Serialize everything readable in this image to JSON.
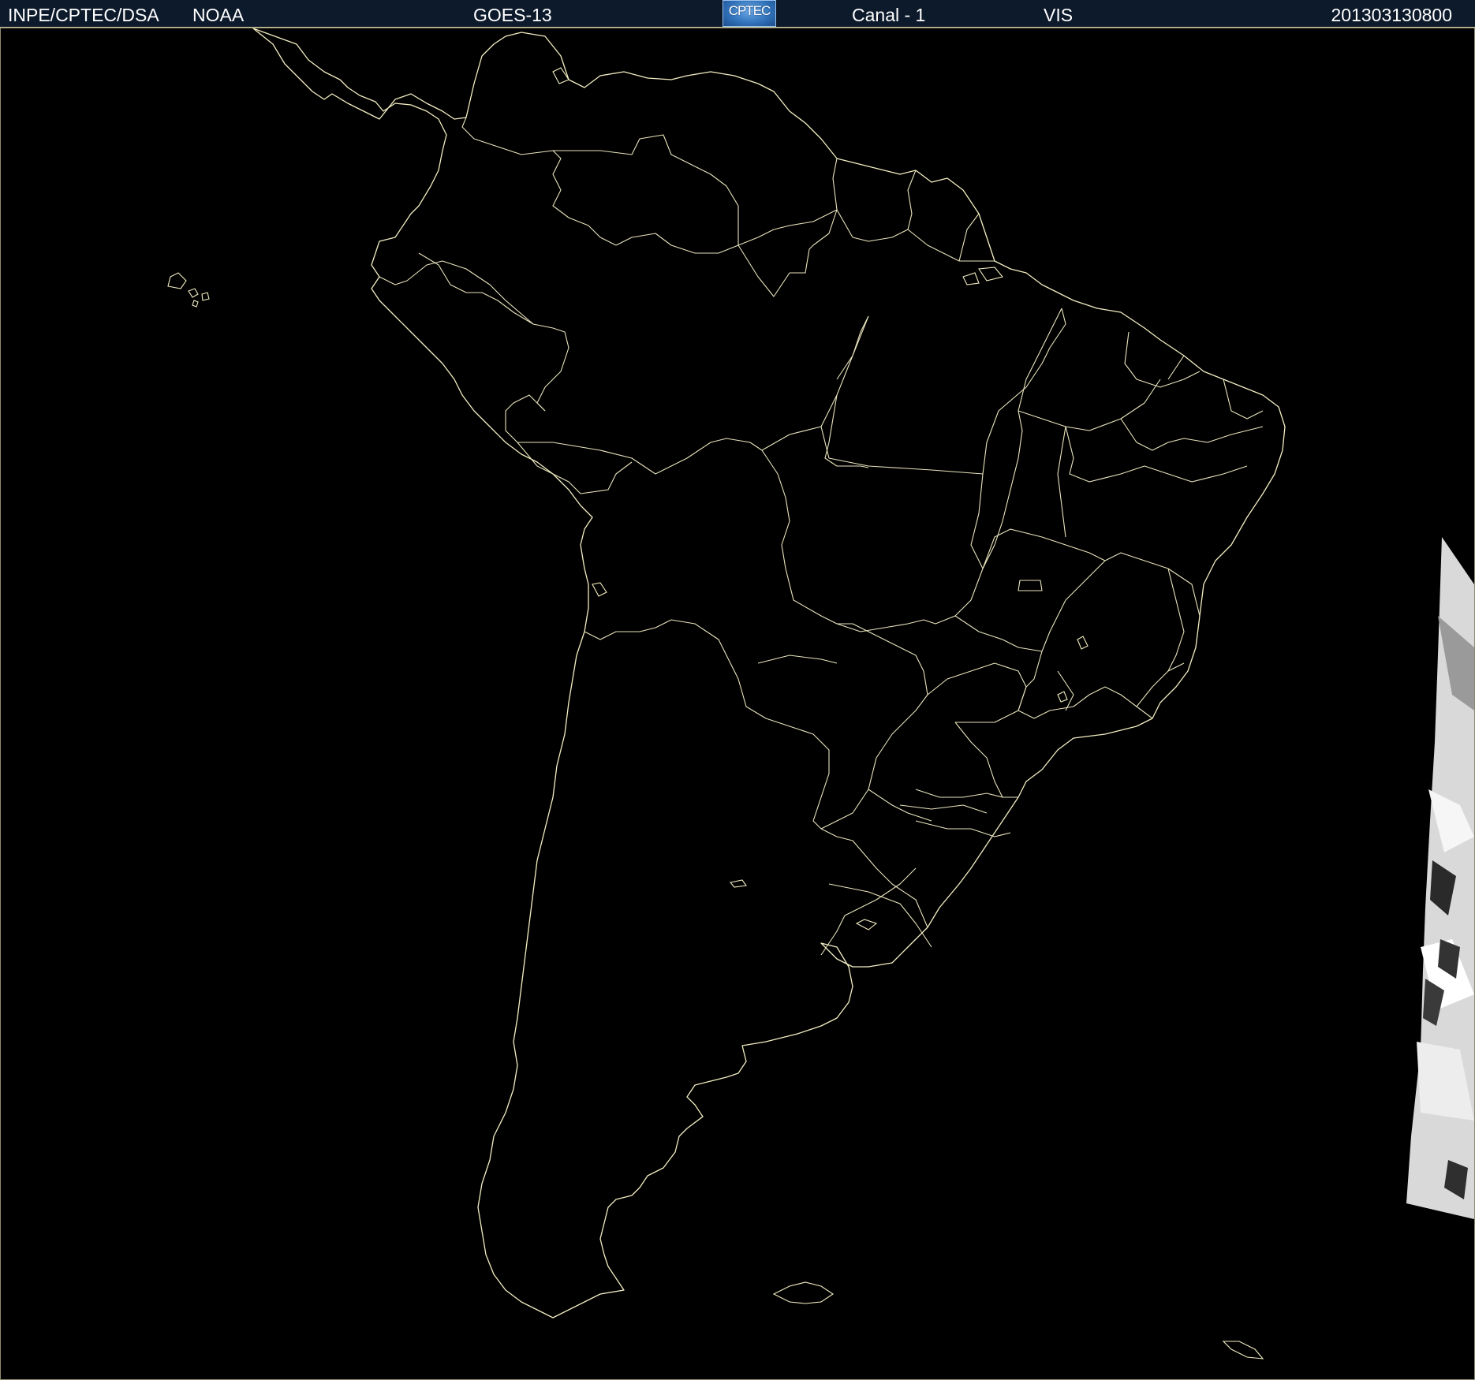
{
  "header": {
    "institution": "INPE/CPTEC/DSA",
    "agency": "NOAA",
    "satellite": "GOES-13",
    "logo_text": "CPTEC",
    "channel": "Canal - 1",
    "band": "VIS",
    "timestamp": "201303130800"
  },
  "map": {
    "region": "South America",
    "background_color": "#000000",
    "boundary_color": "#f3eec3",
    "cloud_color": "#e6e6e6"
  }
}
